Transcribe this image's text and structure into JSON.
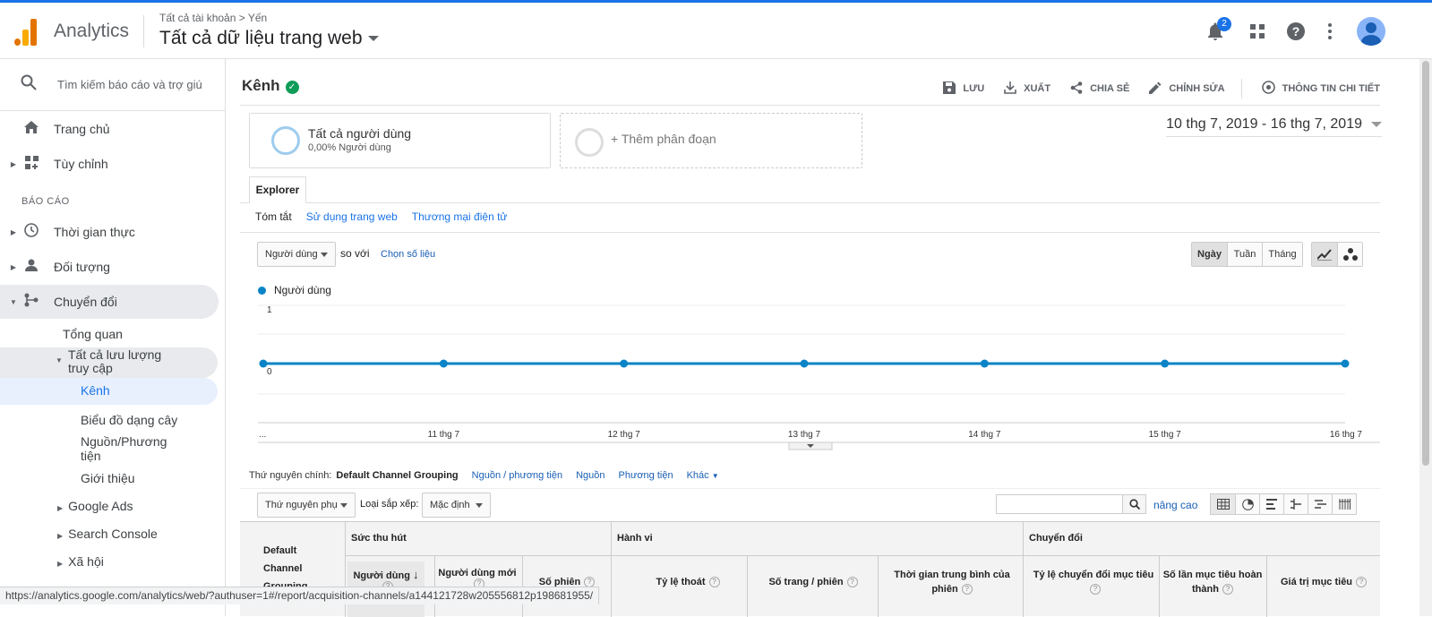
{
  "header": {
    "app_name": "Analytics",
    "breadcrumb": "Tất cả tài khoản > Yến",
    "view_name": "Tất cả dữ liệu trang web",
    "notification_count": "2"
  },
  "sidebar": {
    "search_placeholder": "Tìm kiếm báo cáo và trợ giú",
    "home": "Trang chủ",
    "customize": "Tùy chỉnh",
    "reports_label": "BÁO CÁO",
    "realtime": "Thời gian thực",
    "audience": "Đối tượng",
    "acquisition": "Chuyển đổi",
    "overview": "Tổng quan",
    "all_traffic": "Tất cả lưu lượng truy cập",
    "channels": "Kênh",
    "treemap": "Biểu đồ dạng cây",
    "source_medium": "Nguồn/Phương tiện",
    "referrals": "Giới thiệu",
    "google_ads": "Google Ads",
    "search_console": "Search Console",
    "social": "Xã hội"
  },
  "page": {
    "title": "Kênh",
    "actions": {
      "save": "LƯU",
      "export": "XUẤT",
      "share": "CHIA SẺ",
      "edit": "CHỈNH SỬA",
      "insights": "THÔNG TIN CHI TIẾT"
    },
    "segment_name": "Tất cả người dùng",
    "segment_pct": "0,00% Người dùng",
    "add_segment": "+ Thêm phân đoạn",
    "date_range": "10 thg 7, 2019 - 16 thg 7, 2019",
    "explorer_tab": "Explorer",
    "subtabs": [
      "Tóm tắt",
      "Sử dụng trang web",
      "Thương mại điện tử"
    ],
    "metric_select": "Người dùng",
    "vs_label": "so với",
    "choose_metric": "Chọn số liệu",
    "granularity": [
      "Ngày",
      "Tuần",
      "Tháng"
    ]
  },
  "chart_data": {
    "type": "line",
    "series": [
      {
        "name": "Người dùng",
        "values": [
          0,
          0,
          0,
          0,
          0,
          0,
          0
        ]
      }
    ],
    "categories": [
      "...",
      "11 thg 7",
      "12 thg 7",
      "13 thg 7",
      "14 thg 7",
      "15 thg 7",
      "16 thg 7"
    ],
    "ylim": [
      0,
      1
    ],
    "yticks": [
      "1",
      "0"
    ],
    "color": "#0a84c6",
    "grid": true
  },
  "dimensions": {
    "label": "Thứ nguyên chính:",
    "current": "Default Channel Grouping",
    "others": [
      "Nguồn / phương tiện",
      "Nguồn",
      "Phương tiện",
      "Khác"
    ]
  },
  "table_controls": {
    "secondary_dim": "Thứ nguyên phụ",
    "sort_label": "Loại sắp xếp:",
    "sort_value": "Mặc định",
    "advanced": "nâng cao"
  },
  "table": {
    "first_col": "Default Channel Grouping",
    "groups": [
      "Sức thu hút",
      "Hành vi",
      "Chuyển đổi"
    ],
    "columns": [
      "Người dùng",
      "Người dùng mới",
      "Số phiên",
      "Tỷ lệ thoát",
      "Số trang / phiên",
      "Thời gian trung bình của phiên",
      "Tỷ lệ chuyển đổi mục tiêu",
      "Số lần mục tiêu hoàn thành",
      "Giá trị mục tiêu"
    ]
  },
  "status_url": "https://analytics.google.com/analytics/web/?authuser=1#/report/acquisition-channels/a144121728w205556812p198681955/"
}
